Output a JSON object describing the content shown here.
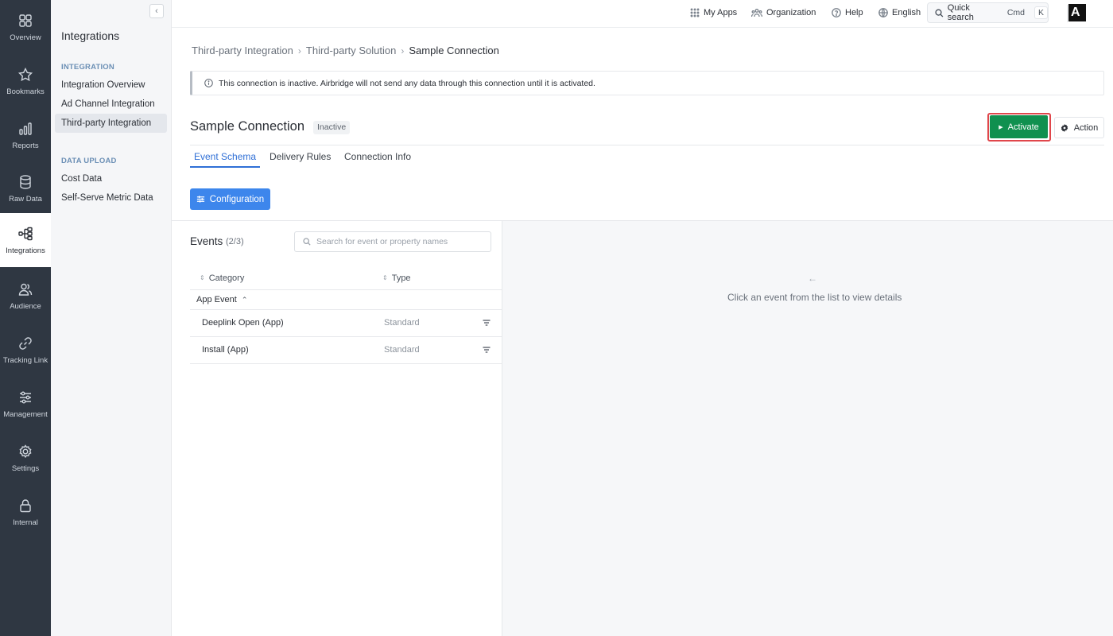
{
  "rail": [
    {
      "label": "Overview",
      "icon": "grid-icon"
    },
    {
      "label": "Bookmarks",
      "icon": "star-icon"
    },
    {
      "label": "Reports",
      "icon": "bar-chart-icon"
    },
    {
      "label": "Raw Data",
      "icon": "database-icon"
    },
    {
      "label": "Integrations",
      "icon": "integrations-icon",
      "active": true
    },
    {
      "label": "Audience",
      "icon": "users-icon"
    },
    {
      "label": "Tracking Link",
      "icon": "link-icon"
    },
    {
      "label": "Management",
      "icon": "sliders-icon"
    },
    {
      "label": "Settings",
      "icon": "gear-icon"
    },
    {
      "label": "Internal",
      "icon": "lock-icon"
    }
  ],
  "subnav": {
    "collapse_label": "‹",
    "title": "Integrations",
    "section_integration": "INTEGRATION",
    "items_integration": [
      "Integration Overview",
      "Ad Channel Integration",
      "Third-party Integration"
    ],
    "section_upload": "DATA UPLOAD",
    "items_upload": [
      "Cost Data",
      "Self-Serve Metric Data"
    ]
  },
  "topbar": {
    "my_apps": "My Apps",
    "organization": "Organization",
    "help": "Help",
    "language": "English",
    "quick_search": "Quick search",
    "shortcut_cmd": "Cmd",
    "shortcut_k": "K",
    "avatar": "A"
  },
  "breadcrumb": [
    "Third-party Integration",
    "Third-party Solution",
    "Sample Connection"
  ],
  "notice": "This connection is inactive. Airbridge will not send any data through this connection until it is activated.",
  "page": {
    "title": "Sample Connection",
    "status": "Inactive",
    "activate": "Activate",
    "action": "Action"
  },
  "tabs": [
    "Event Schema",
    "Delivery Rules",
    "Connection Info"
  ],
  "configuration": "Configuration",
  "events": {
    "title": "Events",
    "count": "(2/3)",
    "search_placeholder": "Search for event or property names",
    "col_category": "Category",
    "col_type": "Type",
    "group": "App Event",
    "rows": [
      {
        "name": "Deeplink Open (App)",
        "type": "Standard"
      },
      {
        "name": "Install (App)",
        "type": "Standard"
      }
    ]
  },
  "detail": {
    "empty_text": "Click an event from the list to view details"
  },
  "colors": {
    "rail_bg": "#2f3742",
    "accent_blue": "#3d86ec",
    "activate_green": "#10904f",
    "highlight_red": "#e0464b"
  }
}
